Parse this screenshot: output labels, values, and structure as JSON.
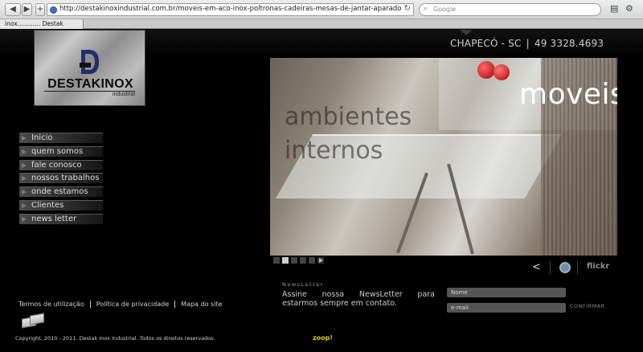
{
  "browser": {
    "url": "http://destakinoxindustrial.com.br/moveis-em-aco-inox-poltronas-cadeiras-mesas-de-jantar-aparadores-mesas-de-centro/destak",
    "search_placeholder": "Google",
    "tab_title": "inox............ Destak"
  },
  "header": {
    "logo_brand": "DESTAKINOX",
    "logo_sub": "industrial",
    "city": "CHAPECÓ - SC",
    "phone": "49 3328.4693"
  },
  "menu": {
    "items": [
      {
        "label": "Inicio"
      },
      {
        "label": "quem somos"
      },
      {
        "label": "fale conosco"
      },
      {
        "label": "nossos trabalhos"
      },
      {
        "label": "onde estamos"
      },
      {
        "label": "Clientes"
      },
      {
        "label": "news letter"
      }
    ]
  },
  "banner": {
    "title": "moveis",
    "line1": "ambientes",
    "line2": "internos",
    "slides": 6,
    "active_slide": 2
  },
  "social": {
    "flickr": "flickr"
  },
  "newsletter": {
    "title": "NewsLetter",
    "text": "Assine nossa NewsLetter para estarmos sempre em contato.",
    "name_placeholder": "Nome",
    "email_placeholder": "e-mail",
    "confirm_label": "CONFIRMAR"
  },
  "footer": {
    "links": [
      {
        "label": "Termos de utilização"
      },
      {
        "label": "Política de privacidade"
      },
      {
        "label": "Mapa do site"
      }
    ],
    "copyright": "Copyright, 2010 - 2011. Destak Inox Industrial. Todos os direitos reservados.",
    "credit": "zoop!"
  }
}
